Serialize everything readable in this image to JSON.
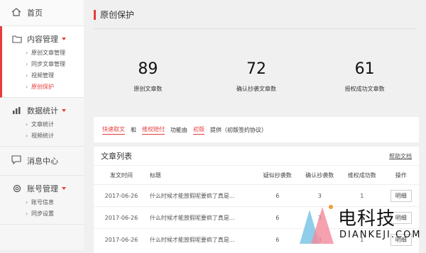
{
  "sidebar": {
    "home": "首页",
    "groups": [
      {
        "label": "内容管理",
        "items": [
          "原创文章管理",
          "同步文章管理",
          "视频管理",
          "原创保护"
        ],
        "current": 3
      },
      {
        "label": "数据统计",
        "items": [
          "文章统计",
          "视频统计"
        ]
      },
      {
        "label": "账号管理",
        "items": [
          "账号信息",
          "同步设置"
        ]
      }
    ],
    "messages": "消息中心"
  },
  "main": {
    "title": "原创保护",
    "stats": [
      {
        "value": "89",
        "label": "原创文章数"
      },
      {
        "value": "72",
        "label": "确认抄袭文章数"
      },
      {
        "value": "61",
        "label": "授权成功文章数"
      }
    ],
    "notice": [
      "快速取文",
      "和",
      "维权赔付",
      "功能由",
      "初版",
      "提供（初版签约协议）"
    ],
    "list": {
      "title": "文章列表",
      "help": "帮助文档",
      "columns": [
        "发文时间",
        "标题",
        "疑似抄袭数",
        "确认抄袭数",
        "维权成功数",
        "操作"
      ],
      "rows": [
        [
          "2017-06-26",
          "什么时候才能放假呢要疯了真是...",
          "6",
          "3",
          "1",
          "明细"
        ],
        [
          "2017-06-26",
          "什么时候才能放假呢要疯了真是...",
          "6",
          "3",
          "1",
          "明细"
        ],
        [
          "2017-06-26",
          "什么时候才能放假呢要疯了真是...",
          "6",
          "3",
          "1",
          "明细"
        ]
      ]
    }
  },
  "watermark": {
    "main": "电科技",
    "sub": "DIANKEJI.COM"
  },
  "colors": {
    "accent": "#e83c3c"
  }
}
